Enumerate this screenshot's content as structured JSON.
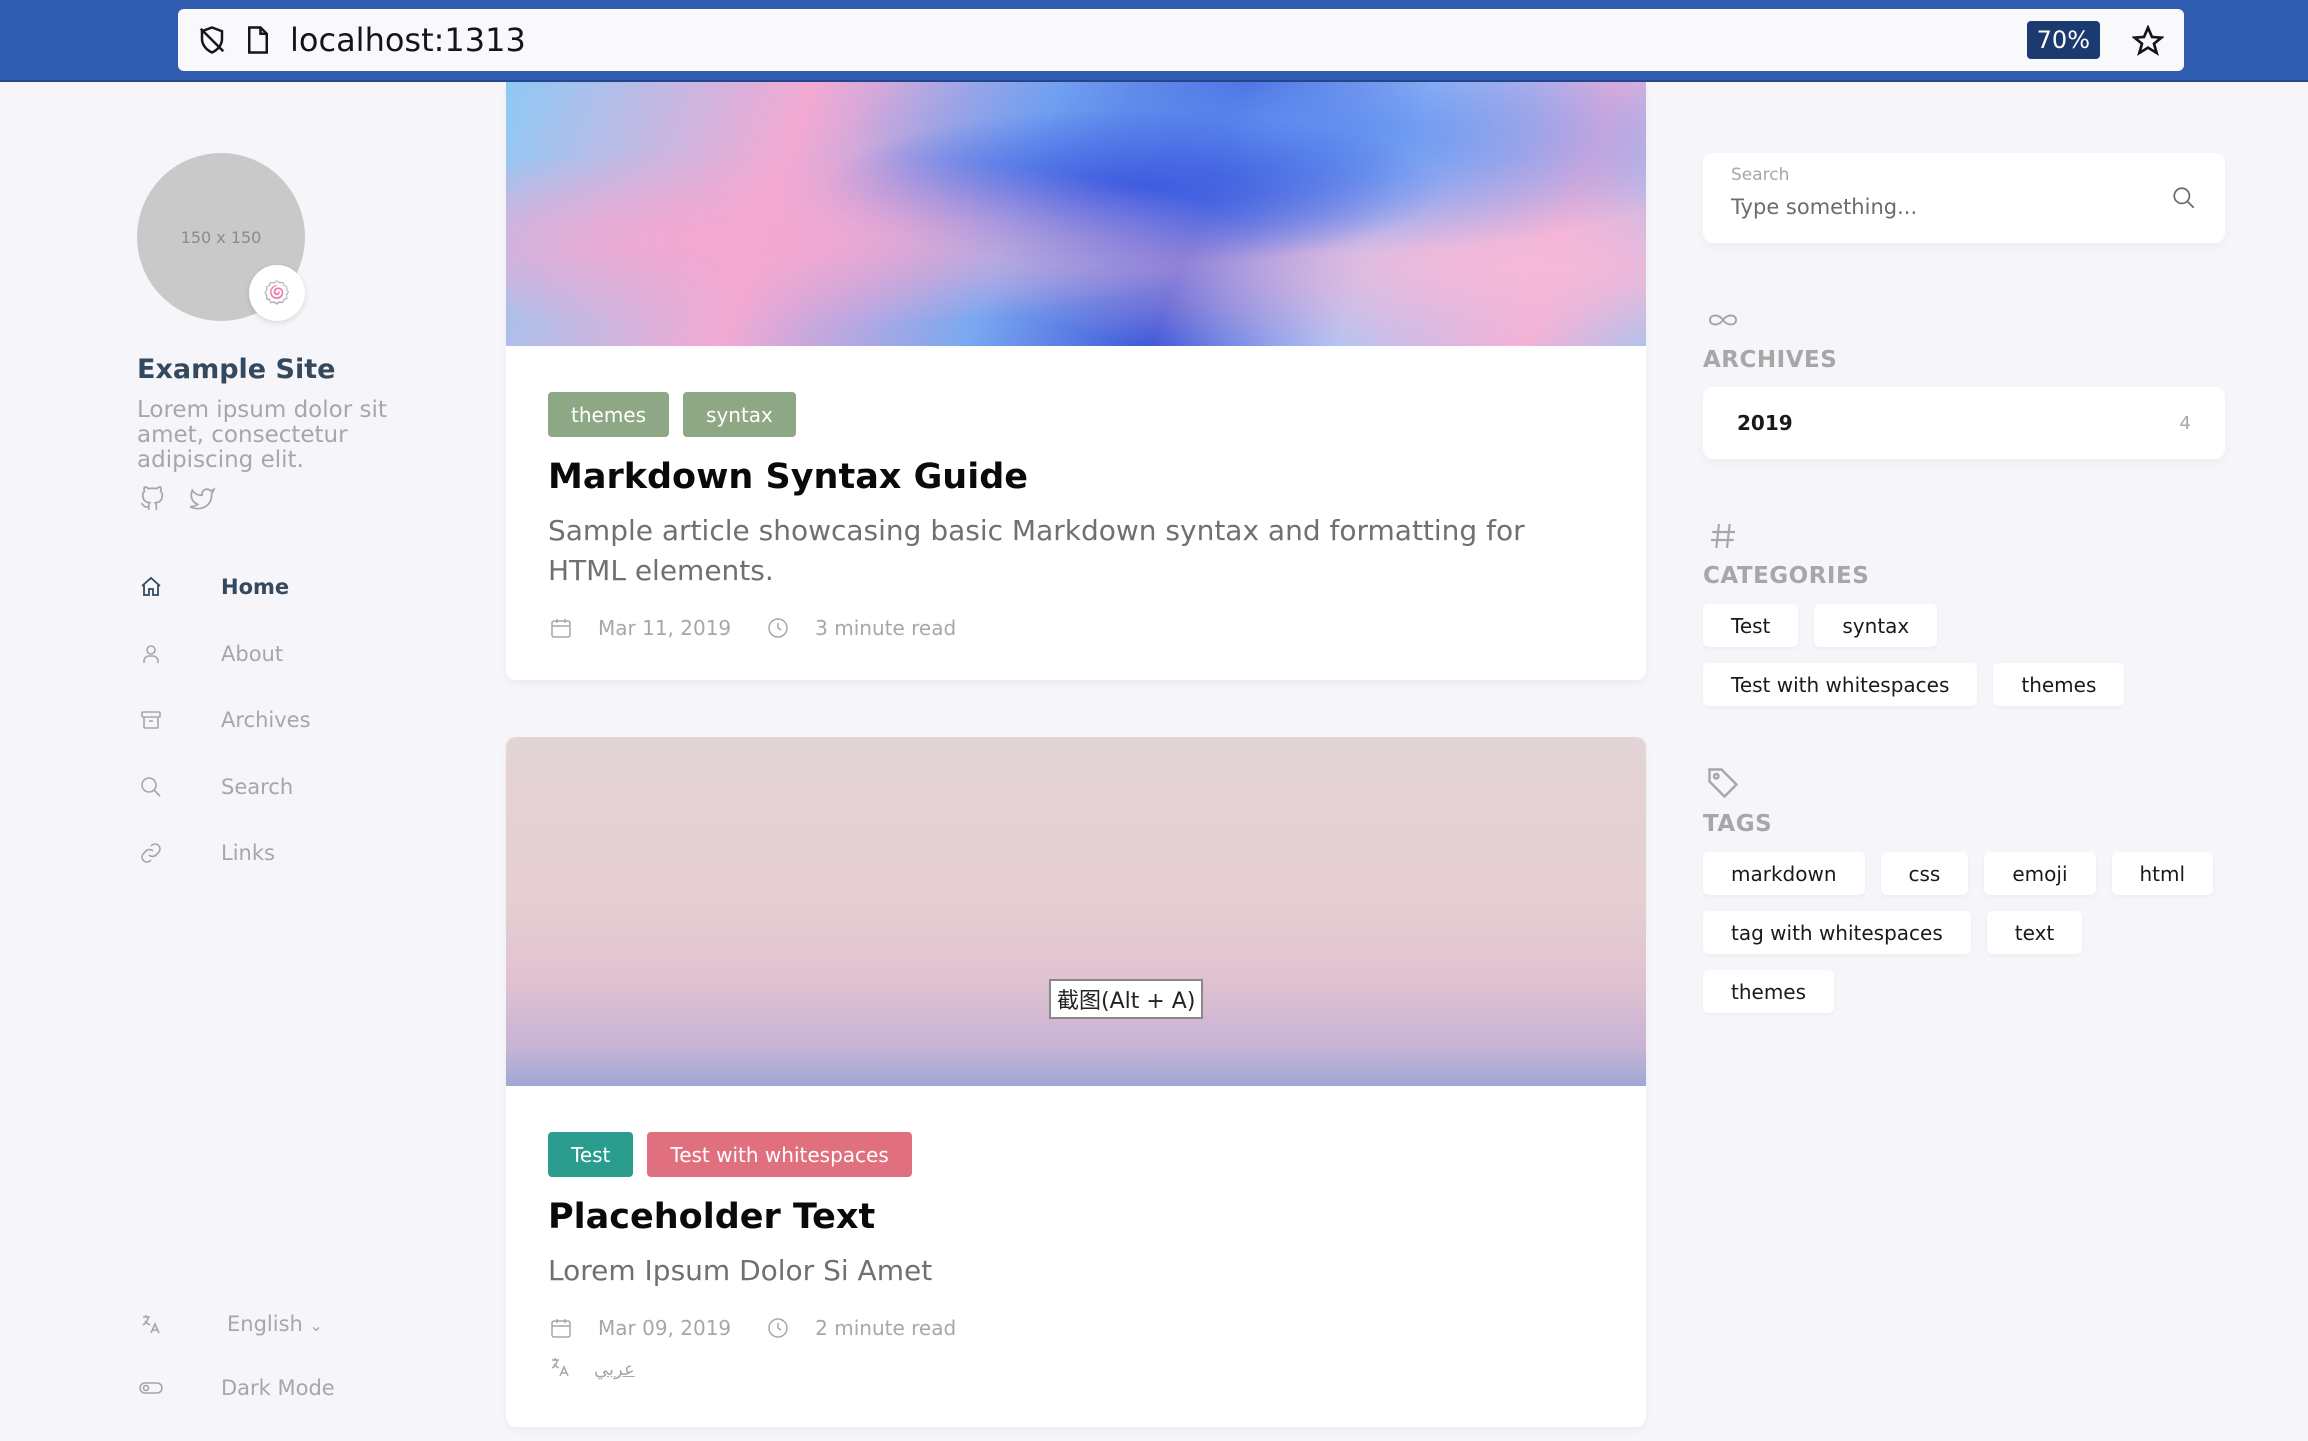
{
  "browser": {
    "url_host": "localhost:",
    "url_port": "1313",
    "zoom": "70%"
  },
  "sidebar": {
    "avatar_placeholder": "150 x 150",
    "avatar_emoji": "🍥",
    "site_name": "Example Site",
    "site_description": "Lorem ipsum dolor sit amet, consectetur adipiscing elit.",
    "nav": [
      {
        "label": "Home",
        "icon": "home-icon",
        "active": true
      },
      {
        "label": "About",
        "icon": "user-icon",
        "active": false
      },
      {
        "label": "Archives",
        "icon": "archive-icon",
        "active": false
      },
      {
        "label": "Search",
        "icon": "search-icon",
        "active": false
      },
      {
        "label": "Links",
        "icon": "link-icon",
        "active": false
      }
    ],
    "language": "English",
    "dark_mode_label": "Dark Mode"
  },
  "posts": [
    {
      "tags": [
        {
          "label": "themes",
          "color": "#8ea885"
        },
        {
          "label": "syntax",
          "color": "#8ea885"
        }
      ],
      "title": "Markdown Syntax Guide",
      "subtitle": "Sample article showcasing basic Markdown syntax and formatting for HTML elements.",
      "date": "Mar 11, 2019",
      "read_time": "3 minute read"
    },
    {
      "tags": [
        {
          "label": "Test",
          "color": "#2a9d8f"
        },
        {
          "label": "Test with whitespaces",
          "color": "#e0707e"
        }
      ],
      "title": "Placeholder Text",
      "subtitle": "Lorem Ipsum Dolor Si Amet",
      "date": "Mar 09, 2019",
      "read_time": "2 minute read",
      "translation": "عربي"
    }
  ],
  "screenshot_tooltip": "截图(Alt + A)",
  "widgets": {
    "search_label": "Search",
    "search_placeholder": "Type something...",
    "archives_title": "ARCHIVES",
    "archives": [
      {
        "year": "2019",
        "count": "4"
      }
    ],
    "categories_title": "CATEGORIES",
    "categories": [
      "Test",
      "syntax",
      "Test with whitespaces",
      "themes"
    ],
    "tags_title": "TAGS",
    "tags": [
      "markdown",
      "css",
      "emoji",
      "html",
      "tag with whitespaces",
      "text",
      "themes"
    ]
  }
}
